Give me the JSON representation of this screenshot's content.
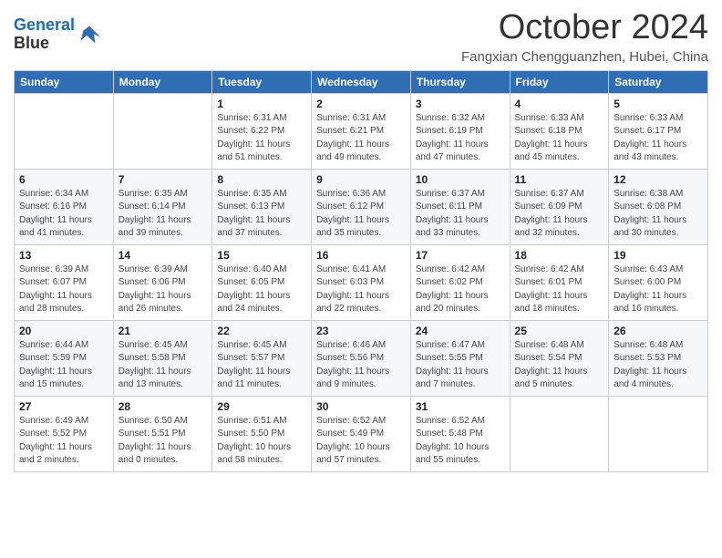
{
  "logo": {
    "line1": "General",
    "line2": "Blue"
  },
  "title": "October 2024",
  "location": "Fangxian Chengguanzhen, Hubei, China",
  "days_of_week": [
    "Sunday",
    "Monday",
    "Tuesday",
    "Wednesday",
    "Thursday",
    "Friday",
    "Saturday"
  ],
  "weeks": [
    [
      {
        "day": "",
        "info": ""
      },
      {
        "day": "",
        "info": ""
      },
      {
        "day": "1",
        "info": "Sunrise: 6:31 AM\nSunset: 6:22 PM\nDaylight: 11 hours and 51 minutes."
      },
      {
        "day": "2",
        "info": "Sunrise: 6:31 AM\nSunset: 6:21 PM\nDaylight: 11 hours and 49 minutes."
      },
      {
        "day": "3",
        "info": "Sunrise: 6:32 AM\nSunset: 6:19 PM\nDaylight: 11 hours and 47 minutes."
      },
      {
        "day": "4",
        "info": "Sunrise: 6:33 AM\nSunset: 6:18 PM\nDaylight: 11 hours and 45 minutes."
      },
      {
        "day": "5",
        "info": "Sunrise: 6:33 AM\nSunset: 6:17 PM\nDaylight: 11 hours and 43 minutes."
      }
    ],
    [
      {
        "day": "6",
        "info": "Sunrise: 6:34 AM\nSunset: 6:16 PM\nDaylight: 11 hours and 41 minutes."
      },
      {
        "day": "7",
        "info": "Sunrise: 6:35 AM\nSunset: 6:14 PM\nDaylight: 11 hours and 39 minutes."
      },
      {
        "day": "8",
        "info": "Sunrise: 6:35 AM\nSunset: 6:13 PM\nDaylight: 11 hours and 37 minutes."
      },
      {
        "day": "9",
        "info": "Sunrise: 6:36 AM\nSunset: 6:12 PM\nDaylight: 11 hours and 35 minutes."
      },
      {
        "day": "10",
        "info": "Sunrise: 6:37 AM\nSunset: 6:11 PM\nDaylight: 11 hours and 33 minutes."
      },
      {
        "day": "11",
        "info": "Sunrise: 6:37 AM\nSunset: 6:09 PM\nDaylight: 11 hours and 32 minutes."
      },
      {
        "day": "12",
        "info": "Sunrise: 6:38 AM\nSunset: 6:08 PM\nDaylight: 11 hours and 30 minutes."
      }
    ],
    [
      {
        "day": "13",
        "info": "Sunrise: 6:39 AM\nSunset: 6:07 PM\nDaylight: 11 hours and 28 minutes."
      },
      {
        "day": "14",
        "info": "Sunrise: 6:39 AM\nSunset: 6:06 PM\nDaylight: 11 hours and 26 minutes."
      },
      {
        "day": "15",
        "info": "Sunrise: 6:40 AM\nSunset: 6:05 PM\nDaylight: 11 hours and 24 minutes."
      },
      {
        "day": "16",
        "info": "Sunrise: 6:41 AM\nSunset: 6:03 PM\nDaylight: 11 hours and 22 minutes."
      },
      {
        "day": "17",
        "info": "Sunrise: 6:42 AM\nSunset: 6:02 PM\nDaylight: 11 hours and 20 minutes."
      },
      {
        "day": "18",
        "info": "Sunrise: 6:42 AM\nSunset: 6:01 PM\nDaylight: 11 hours and 18 minutes."
      },
      {
        "day": "19",
        "info": "Sunrise: 6:43 AM\nSunset: 6:00 PM\nDaylight: 11 hours and 16 minutes."
      }
    ],
    [
      {
        "day": "20",
        "info": "Sunrise: 6:44 AM\nSunset: 5:59 PM\nDaylight: 11 hours and 15 minutes."
      },
      {
        "day": "21",
        "info": "Sunrise: 6:45 AM\nSunset: 5:58 PM\nDaylight: 11 hours and 13 minutes."
      },
      {
        "day": "22",
        "info": "Sunrise: 6:45 AM\nSunset: 5:57 PM\nDaylight: 11 hours and 11 minutes."
      },
      {
        "day": "23",
        "info": "Sunrise: 6:46 AM\nSunset: 5:56 PM\nDaylight: 11 hours and 9 minutes."
      },
      {
        "day": "24",
        "info": "Sunrise: 6:47 AM\nSunset: 5:55 PM\nDaylight: 11 hours and 7 minutes."
      },
      {
        "day": "25",
        "info": "Sunrise: 6:48 AM\nSunset: 5:54 PM\nDaylight: 11 hours and 5 minutes."
      },
      {
        "day": "26",
        "info": "Sunrise: 6:48 AM\nSunset: 5:53 PM\nDaylight: 11 hours and 4 minutes."
      }
    ],
    [
      {
        "day": "27",
        "info": "Sunrise: 6:49 AM\nSunset: 5:52 PM\nDaylight: 11 hours and 2 minutes."
      },
      {
        "day": "28",
        "info": "Sunrise: 6:50 AM\nSunset: 5:51 PM\nDaylight: 11 hours and 0 minutes."
      },
      {
        "day": "29",
        "info": "Sunrise: 6:51 AM\nSunset: 5:50 PM\nDaylight: 10 hours and 58 minutes."
      },
      {
        "day": "30",
        "info": "Sunrise: 6:52 AM\nSunset: 5:49 PM\nDaylight: 10 hours and 57 minutes."
      },
      {
        "day": "31",
        "info": "Sunrise: 6:52 AM\nSunset: 5:48 PM\nDaylight: 10 hours and 55 minutes."
      },
      {
        "day": "",
        "info": ""
      },
      {
        "day": "",
        "info": ""
      }
    ]
  ]
}
